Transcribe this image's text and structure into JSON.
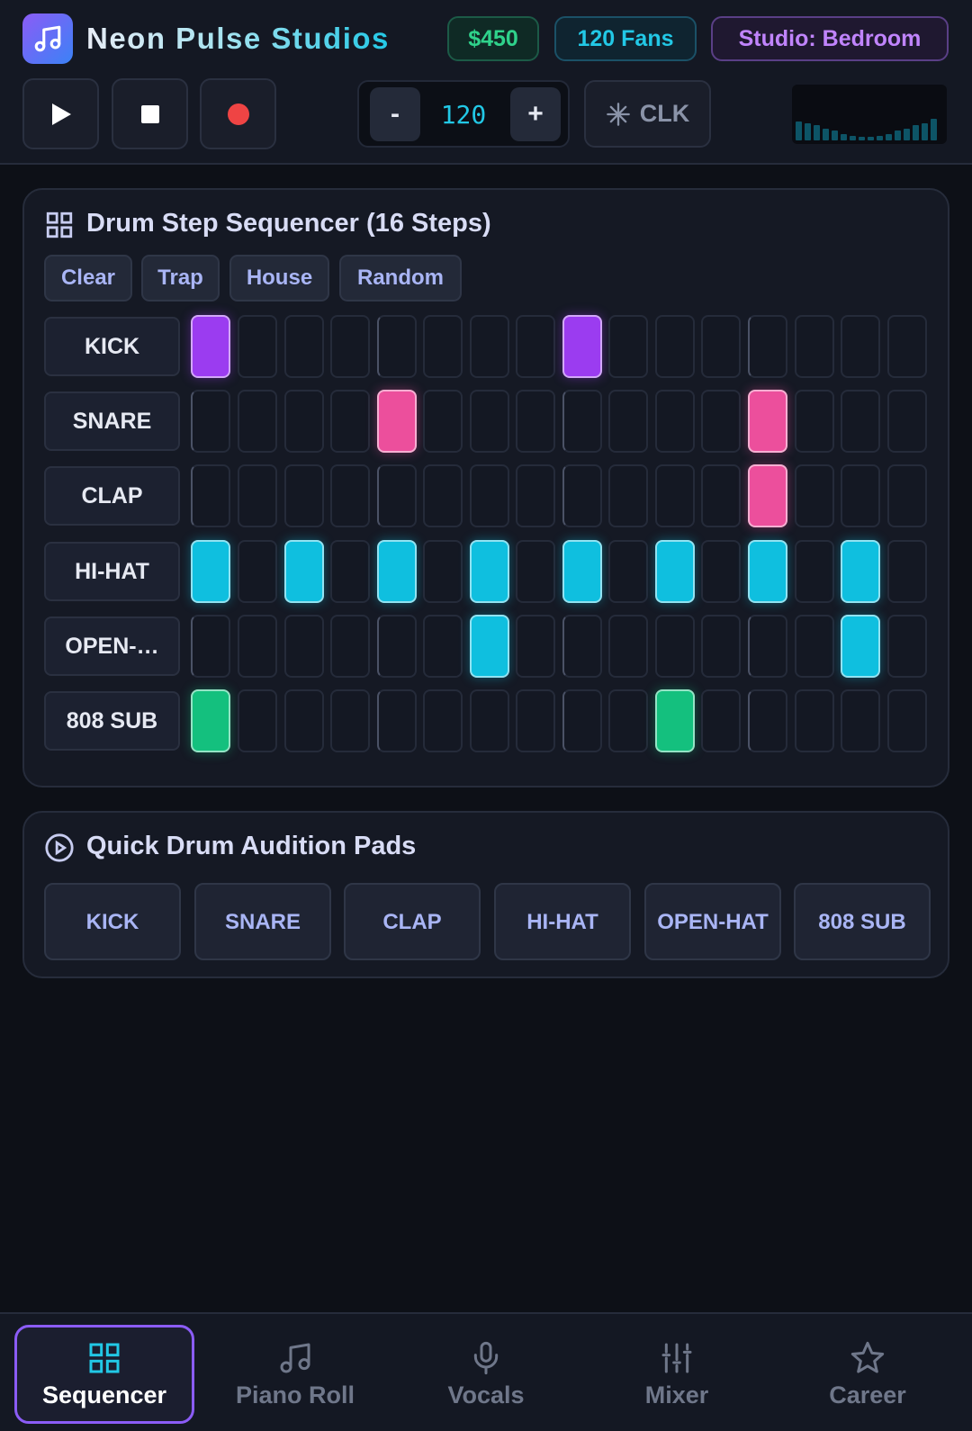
{
  "header": {
    "title_part1": "Neon ",
    "title_part2": "Pulse Studios",
    "logo_icon": "music-note-icon",
    "money": "$450",
    "fans": "120 Fans",
    "studio": "Studio: Bedroom"
  },
  "transport": {
    "play_icon": "play-icon",
    "stop_icon": "stop-icon",
    "record_icon": "record-icon",
    "tempo_minus": "-",
    "tempo_value": "120",
    "tempo_plus": "+",
    "clock_label": "CLK",
    "meter_levels": [
      0.35,
      0.32,
      0.28,
      0.22,
      0.18,
      0.12,
      0.08,
      0.06,
      0.06,
      0.08,
      0.12,
      0.18,
      0.22,
      0.28,
      0.32,
      0.4
    ]
  },
  "sequencer": {
    "title": "Drum Step Sequencer (16 Steps)",
    "presets": [
      "Clear",
      "Trap",
      "House",
      "Random"
    ],
    "rows": [
      {
        "label": "KICK",
        "color": "#9b3cf0",
        "steps": [
          1,
          0,
          0,
          0,
          0,
          0,
          0,
          0,
          1,
          0,
          0,
          0,
          0,
          0,
          0,
          0
        ]
      },
      {
        "label": "SNARE",
        "color": "#ec4f9c",
        "steps": [
          0,
          0,
          0,
          0,
          1,
          0,
          0,
          0,
          0,
          0,
          0,
          0,
          1,
          0,
          0,
          0
        ]
      },
      {
        "label": "CLAP",
        "color": "#ec4f9c",
        "steps": [
          0,
          0,
          0,
          0,
          0,
          0,
          0,
          0,
          0,
          0,
          0,
          0,
          1,
          0,
          0,
          0
        ]
      },
      {
        "label": "HI-HAT",
        "color": "#0fbfdf",
        "steps": [
          1,
          0,
          1,
          0,
          1,
          0,
          1,
          0,
          1,
          0,
          1,
          0,
          1,
          0,
          1,
          0
        ]
      },
      {
        "label": "OPEN-…",
        "color": "#0fbfdf",
        "steps": [
          0,
          0,
          0,
          0,
          0,
          0,
          1,
          0,
          0,
          0,
          0,
          0,
          0,
          0,
          1,
          0
        ]
      },
      {
        "label": "808 SUB",
        "color": "#14c07e",
        "steps": [
          1,
          0,
          0,
          0,
          0,
          0,
          0,
          0,
          0,
          0,
          1,
          0,
          0,
          0,
          0,
          0
        ]
      }
    ]
  },
  "pads": {
    "title": "Quick Drum Audition Pads",
    "items": [
      "KICK",
      "SNARE",
      "CLAP",
      "HI-HAT",
      "OPEN-HAT",
      "808 SUB"
    ]
  },
  "nav": {
    "items": [
      {
        "label": "Sequencer",
        "icon": "grid-icon",
        "active": true
      },
      {
        "label": "Piano Roll",
        "icon": "music-note-icon",
        "active": false
      },
      {
        "label": "Vocals",
        "icon": "microphone-icon",
        "active": false
      },
      {
        "label": "Mixer",
        "icon": "mixer-icon",
        "active": false
      },
      {
        "label": "Career",
        "icon": "star-icon",
        "active": false
      }
    ]
  },
  "colors": {
    "accent_purple": "#8b5cf6",
    "accent_cyan": "#22c8e6",
    "accent_green": "#2fd28b",
    "record_red": "#ef4444"
  }
}
